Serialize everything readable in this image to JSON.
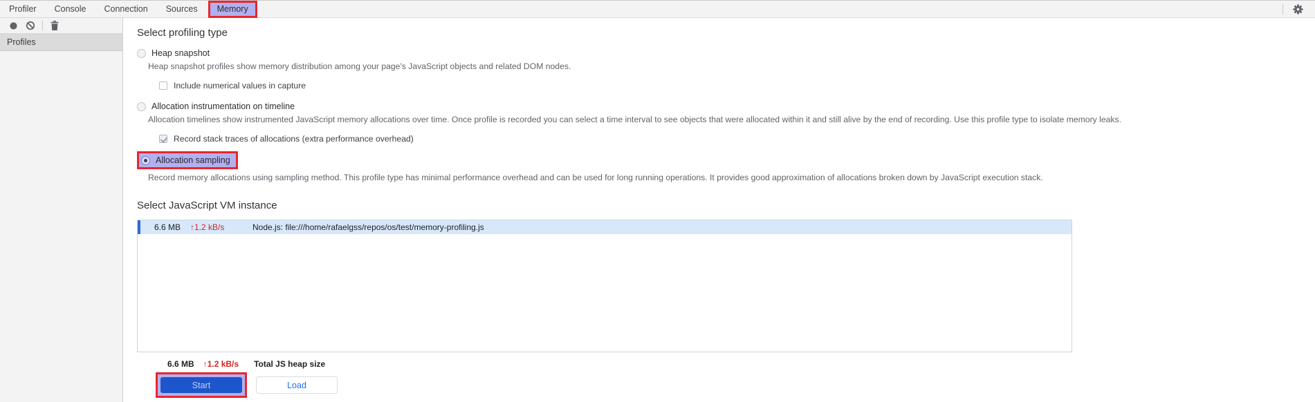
{
  "tabs": {
    "items": [
      "Profiler",
      "Console",
      "Connection",
      "Sources",
      "Memory"
    ],
    "selected": "Memory"
  },
  "toolbar": {
    "icons": [
      "record-icon",
      "clear-icon",
      "delete-icon"
    ]
  },
  "sidebar": {
    "header": "Profiles"
  },
  "header_icons": {
    "settings": "gear-icon"
  },
  "profiling": {
    "title": "Select profiling type",
    "options": [
      {
        "label": "Heap snapshot",
        "selected": false,
        "description": "Heap snapshot profiles show memory distribution among your page's JavaScript objects and related DOM nodes.",
        "checkbox": {
          "label": "Include numerical values in capture",
          "checked": false
        }
      },
      {
        "label": "Allocation instrumentation on timeline",
        "selected": false,
        "description": "Allocation timelines show instrumented JavaScript memory allocations over time. Once profile is recorded you can select a time interval to see objects that were allocated within it and still alive by the end of recording. Use this profile type to isolate memory leaks.",
        "checkbox": {
          "label": "Record stack traces of allocations (extra performance overhead)",
          "checked": true,
          "disabled": true
        }
      },
      {
        "label": "Allocation sampling",
        "selected": true,
        "annotated": true,
        "description": "Record memory allocations using sampling method. This profile type has minimal performance overhead and can be used for long running operations. It provides good approximation of allocations broken down by JavaScript execution stack."
      }
    ]
  },
  "vm": {
    "title": "Select JavaScript VM instance",
    "instances": [
      {
        "size": "6.6 MB",
        "rate": "↑1.2 kB/s",
        "name": "Node.js: file:///home/rafaelgss/repos/os/test/memory-profiling.js",
        "selected": true
      }
    ],
    "total": {
      "size": "6.6 MB",
      "rate": "↑1.2 kB/s",
      "label": "Total JS heap size"
    }
  },
  "actions": {
    "start_label": "Start",
    "load_label": "Load"
  },
  "colors": {
    "annotation_red": "#e8262d",
    "annotation_highlight": "#b3b0ef",
    "selected_row_bg": "#d7e8fb",
    "selected_row_bar": "#2e6bd8",
    "rate_red": "#cf2721",
    "start_button_bg": "#1d55cc",
    "load_button_text": "#1a6ef2",
    "toolbar_bg": "#f3f3f3"
  }
}
